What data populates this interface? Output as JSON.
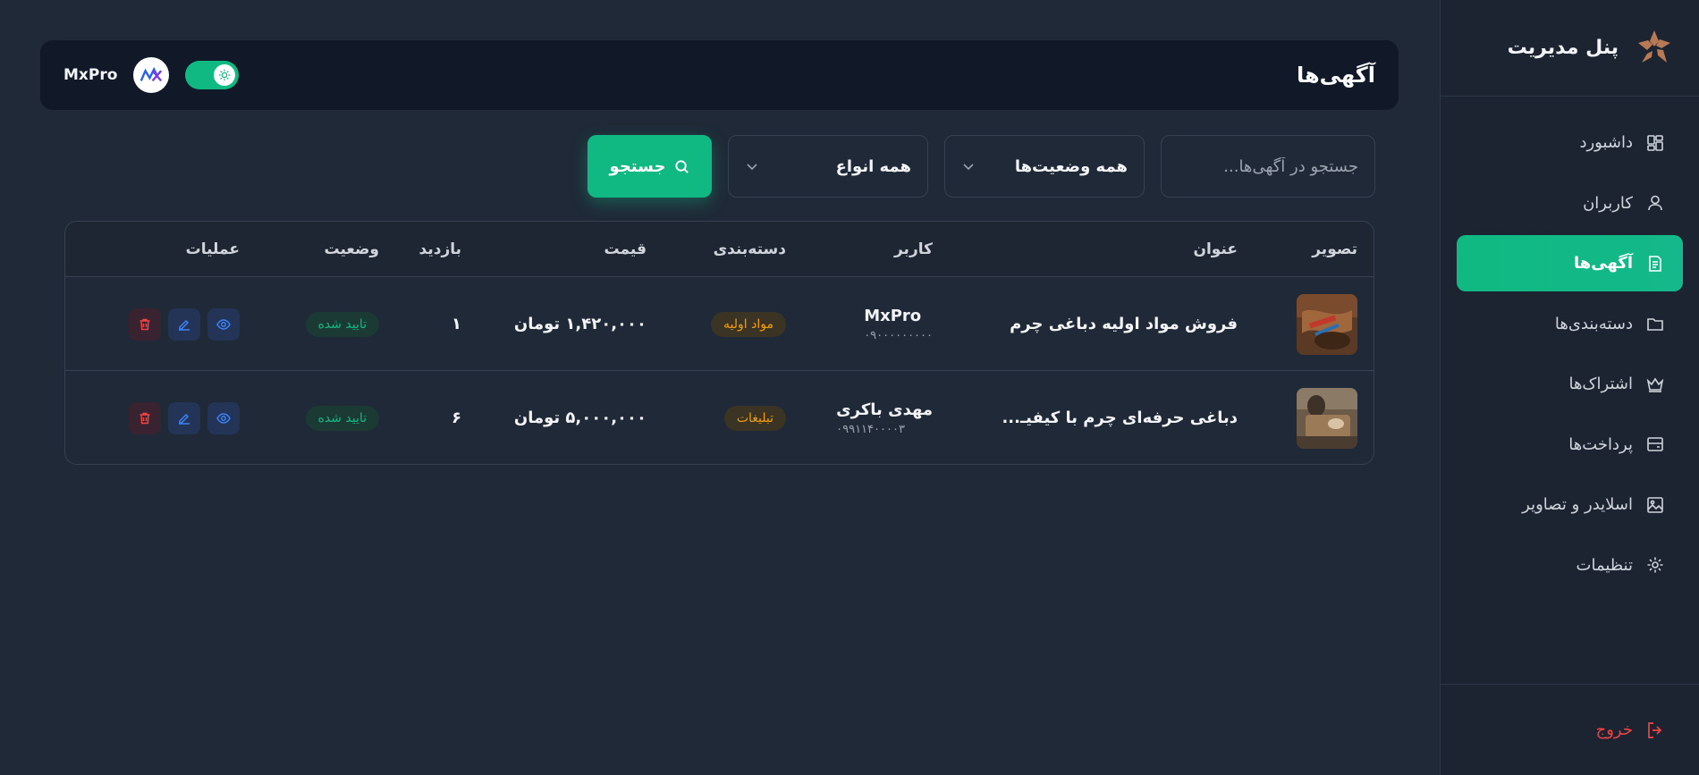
{
  "sidebar": {
    "brand_title": "پنل مدیریت",
    "items": [
      {
        "label": "داشبورد",
        "icon": "dashboard-icon",
        "active": false
      },
      {
        "label": "کاربران",
        "icon": "user-icon",
        "active": false
      },
      {
        "label": "آگهی‌ها",
        "icon": "document-icon",
        "active": true
      },
      {
        "label": "دسته‌بندی‌ها",
        "icon": "folder-icon",
        "active": false
      },
      {
        "label": "اشتراک‌ها",
        "icon": "crown-icon",
        "active": false
      },
      {
        "label": "پرداخت‌ها",
        "icon": "wallet-icon",
        "active": false
      },
      {
        "label": "اسلایدر و تصاویر",
        "icon": "image-icon",
        "active": false
      },
      {
        "label": "تنظیمات",
        "icon": "gear-icon",
        "active": false
      }
    ],
    "logout_label": "خروج"
  },
  "header": {
    "title": "آگهی‌ها",
    "username": "MxPro",
    "theme_toggle": "on"
  },
  "filters": {
    "search_placeholder": "جستجو در آگهی‌ها...",
    "status_select": "همه وضعیت‌ها",
    "type_select": "همه انواع",
    "search_button": "جستجو"
  },
  "table": {
    "columns": [
      "تصویر",
      "عنوان",
      "کاربر",
      "دسته‌بندی",
      "قیمت",
      "بازدید",
      "وضعیت",
      "عملیات"
    ],
    "rows": [
      {
        "title": "فروش مواد اولیه دباغی چرم",
        "user_name": "MxPro",
        "user_phone": "۰۹۰۰۰۰۰۰۰۰۰",
        "category": "مواد اولیه",
        "price": "۱,۴۲۰,۰۰۰ تومان",
        "visits": "۱",
        "status": "تایید شده"
      },
      {
        "title": "دباغی حرفه‌ای چرم با کیفیـ...",
        "user_name": "مهدی باکری",
        "user_phone": "۰۹۹۱۱۴۰۰۰۰۳",
        "category": "تبلیغات",
        "price": "۵,۰۰۰,۰۰۰ تومان",
        "visits": "۶",
        "status": "تایید شده"
      }
    ]
  },
  "colors": {
    "background": "#1f2937",
    "accent": "#10b981",
    "danger": "#ef4444",
    "info": "#3b82f6",
    "warning": "#f59e0b"
  }
}
